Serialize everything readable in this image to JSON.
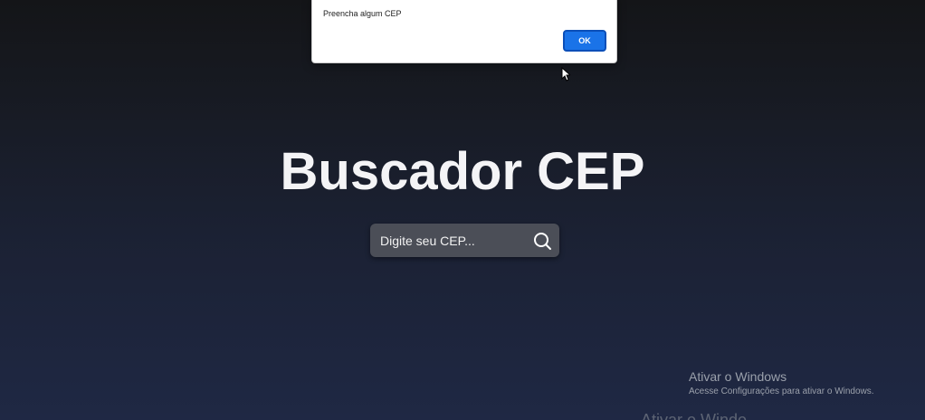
{
  "alert": {
    "message": "Preencha algum CEP",
    "ok_label": "OK"
  },
  "page": {
    "title": "Buscador CEP"
  },
  "search": {
    "placeholder": "Digite seu CEP...",
    "value": "",
    "icon": "search-icon"
  },
  "watermark": {
    "title": "Ativar o Windows",
    "subtitle": "Acesse Configurações para ativar o Windows.",
    "ghost_text": "Ativar o Windo"
  },
  "colors": {
    "background_top": "#141518",
    "background_bottom": "#1f2844",
    "search_box": "#4b4e57",
    "ok_button": "#1a73e8"
  }
}
